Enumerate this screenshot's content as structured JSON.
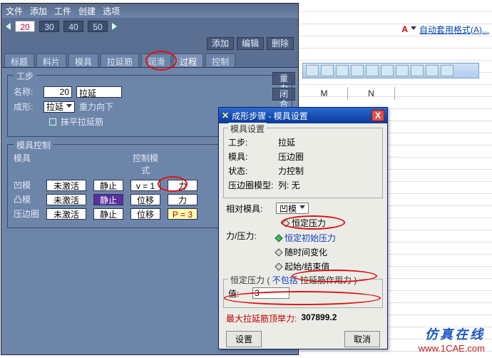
{
  "menubar": {
    "file": "文件",
    "add": "添加",
    "work": "工件",
    "create": "创建",
    "option": "选项"
  },
  "numpages": {
    "p20": "20",
    "p30": "30",
    "p40": "40",
    "p50": "50"
  },
  "topbtns": {
    "add": "添加",
    "edit": "编辑",
    "delete": "删除"
  },
  "ribbon": {
    "style": "自动套用格式(A)..."
  },
  "tabs": {
    "title": "标题",
    "sheet": "料片",
    "mold": "模具",
    "drawbead": "拉延筋",
    "lube": "润滑",
    "process": "过程",
    "control": "控制"
  },
  "sidebtns": {
    "gravity": "重力",
    "close": "闭合"
  },
  "step": {
    "group": "工步",
    "name_label": "名称:",
    "name_num": "20",
    "name_text": "拉延",
    "form_label": "成形:",
    "form_value": "拉延",
    "gravity_label": "重力向下",
    "mohei": "抹平拉延筋"
  },
  "mold": {
    "group": "模具控制",
    "col_mold": "模具",
    "col_modes": "控制模式",
    "rows": [
      {
        "name": "凹模",
        "state": "未激活",
        "s2": "静止",
        "mode": "v = 1",
        "force": "力"
      },
      {
        "name": "凸模",
        "state": "未激活",
        "s2": "静止",
        "mode": "位移",
        "force": "力"
      },
      {
        "name": "压边圈",
        "state": "未激活",
        "s2": "静止",
        "mode": "位移",
        "force": "P = 3"
      }
    ]
  },
  "dlg": {
    "title": "成形步骤 - 模具设置",
    "settings_group": "模具设置",
    "lines": {
      "step_k": "工步:",
      "step_v": "拉延",
      "mold_k": "模具:",
      "mold_v": "压边圈",
      "state_k": "状态:",
      "state_v": "力控制",
      "col_k": "压边圈模型:",
      "col_v": "列: 无"
    },
    "rel_k": "相对模具:",
    "rel_v": "凹模",
    "force_k": "力/压力:",
    "opts": {
      "const_p": "恒定压力",
      "init_p": "恒定初始压力",
      "time_p": "随时间变化",
      "range_p": "起始/结束值"
    },
    "constp_group": "恒定压力  (",
    "include": "不包括",
    "include_tail": " 拉延筋作用力 )",
    "val_label": "值:",
    "val_value": "3",
    "max_label": "最大拉延筋顶举力:",
    "max_value": "307899.2",
    "set": "设置",
    "cancel": "取消"
  },
  "sheet_cols": {
    "m": "M",
    "n": "N"
  },
  "footer": {
    "brand": "仿真在线",
    "url": "www.1CAE.com"
  },
  "watermark": "1CAE.com"
}
